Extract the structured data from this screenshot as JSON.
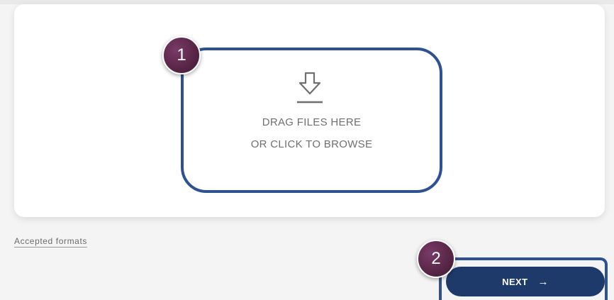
{
  "uploader": {
    "line1": "DRAG FILES HERE",
    "line2": "OR CLICK TO BROWSE",
    "icon": "download-icon"
  },
  "annotations": {
    "badge1": "1",
    "badge2": "2"
  },
  "footer": {
    "accepted_formats_label": "Accepted formats"
  },
  "actions": {
    "next_label": "NEXT",
    "next_icon": "arrow-right-icon",
    "next_arrow": "→"
  },
  "colors": {
    "highlight_border": "#2e5291",
    "next_button_bg": "#1e3a6b",
    "badge_bg": "#5a2748",
    "page_bg": "#f4f4f4"
  }
}
